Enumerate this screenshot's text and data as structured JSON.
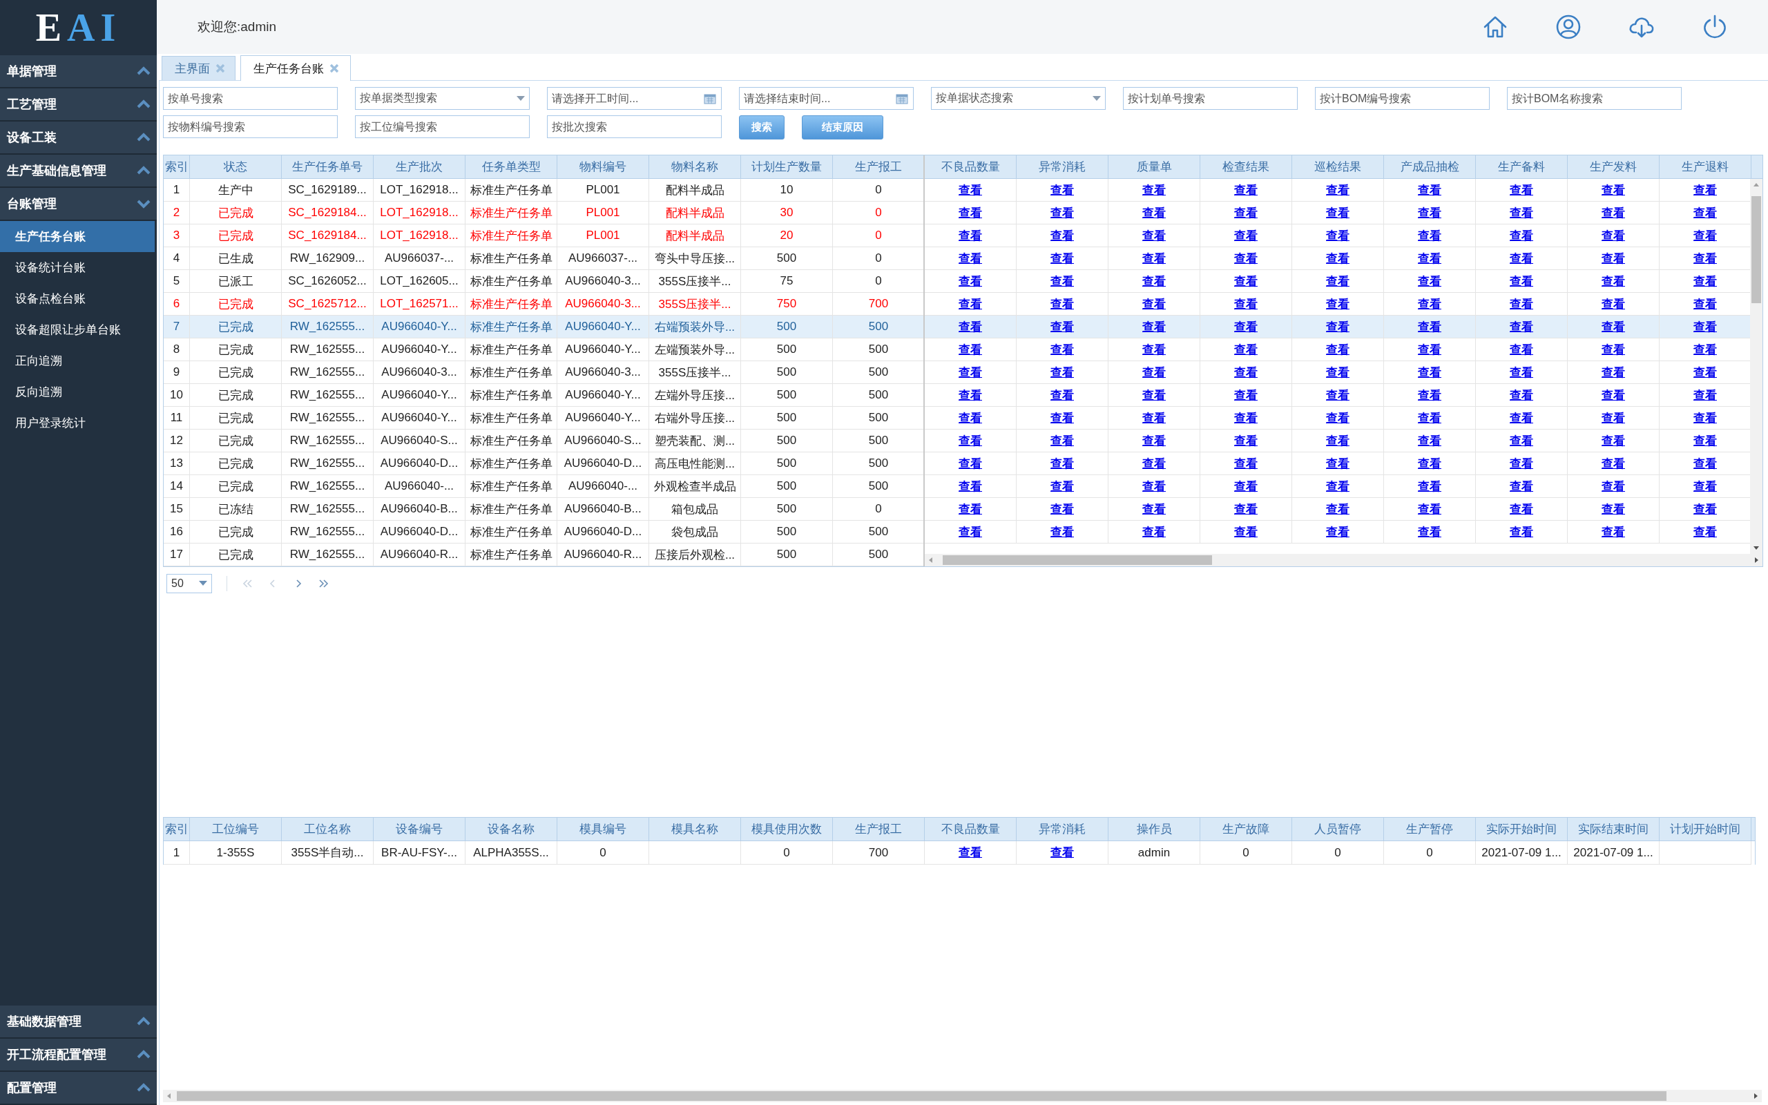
{
  "logo": [
    {
      "text": "E",
      "accent": false
    },
    {
      "text": "AI",
      "accent": true
    }
  ],
  "header": {
    "welcome": "欢迎您:admin"
  },
  "sidebar": {
    "groups": [
      {
        "label": "单据管理",
        "expanded": false
      },
      {
        "label": "工艺管理",
        "expanded": false
      },
      {
        "label": "设备工装",
        "expanded": false
      },
      {
        "label": "生产基础信息管理",
        "expanded": false
      },
      {
        "label": "台账管理",
        "expanded": true,
        "children": [
          {
            "label": "生产任务台账",
            "selected": true
          },
          {
            "label": "设备统计台账",
            "selected": false
          },
          {
            "label": "设备点检台账",
            "selected": false
          },
          {
            "label": "设备超限让步单台账",
            "selected": false
          },
          {
            "label": "正向追溯",
            "selected": false
          },
          {
            "label": "反向追溯",
            "selected": false
          },
          {
            "label": "用户登录统计",
            "selected": false
          }
        ]
      }
    ],
    "bottom_groups": [
      {
        "label": "基础数据管理",
        "expanded": false
      },
      {
        "label": "开工流程配置管理",
        "expanded": false
      },
      {
        "label": "配置管理",
        "expanded": false
      }
    ]
  },
  "tabs": [
    {
      "label": "主界面",
      "selected": false
    },
    {
      "label": "生产任务台账",
      "selected": true
    }
  ],
  "filters": [
    [
      {
        "kind": "text",
        "placeholder": "按单号搜索"
      },
      {
        "kind": "select",
        "placeholder": "按单据类型搜索"
      },
      {
        "kind": "date",
        "placeholder": "请选择开工时间..."
      },
      {
        "kind": "date",
        "placeholder": "请选择结束时间..."
      },
      {
        "kind": "select",
        "placeholder": "按单据状态搜索"
      },
      {
        "kind": "text",
        "placeholder": "按计划单号搜索"
      },
      {
        "kind": "text",
        "placeholder": "按计BOM编号搜索"
      },
      {
        "kind": "text",
        "placeholder": "按计BOM名称搜索"
      }
    ],
    [
      {
        "kind": "text",
        "placeholder": "按物料编号搜索"
      },
      {
        "kind": "text",
        "placeholder": "按工位编号搜索"
      },
      {
        "kind": "text",
        "placeholder": "按批次搜索"
      },
      {
        "kind": "button",
        "label": "搜索"
      },
      {
        "kind": "button",
        "label": "结束原因"
      }
    ]
  ],
  "top_table": {
    "columns": [
      "索引",
      "状态",
      "生产任务单号",
      "生产批次",
      "任务单类型",
      "物料编号",
      "物料名称",
      "计划生产数量",
      "生产报工"
    ],
    "link_columns": [
      "不良品数量",
      "异常消耗",
      "质量单",
      "检查结果",
      "巡检结果",
      "产成品抽检",
      "生产备料",
      "生产发料",
      "生产退料"
    ],
    "rows": [
      {
        "selected": false,
        "alert": false,
        "cells": [
          "1",
          "生产中",
          "SC_1629189...",
          "LOT_162918...",
          "标准生产任务单",
          "PL001",
          "配料半成品",
          "10",
          "0"
        ],
        "links": [
          "查看",
          "查看",
          "查看",
          "查看",
          "查看",
          "查看",
          "查看",
          "查看",
          "查看"
        ]
      },
      {
        "selected": false,
        "alert": true,
        "cells": [
          "2",
          "已完成",
          "SC_1629184...",
          "LOT_162918...",
          "标准生产任务单",
          "PL001",
          "配料半成品",
          "30",
          "0"
        ],
        "links": [
          "查看",
          "查看",
          "查看",
          "查看",
          "查看",
          "查看",
          "查看",
          "查看",
          "查看"
        ]
      },
      {
        "selected": false,
        "alert": true,
        "cells": [
          "3",
          "已完成",
          "SC_1629184...",
          "LOT_162918...",
          "标准生产任务单",
          "PL001",
          "配料半成品",
          "20",
          "0"
        ],
        "links": [
          "查看",
          "查看",
          "查看",
          "查看",
          "查看",
          "查看",
          "查看",
          "查看",
          "查看"
        ]
      },
      {
        "selected": false,
        "alert": false,
        "cells": [
          "4",
          "已生成",
          "RW_162909...",
          "AU966037-...",
          "标准生产任务单",
          "AU966037-...",
          "弯头中导压接...",
          "500",
          "0"
        ],
        "links": [
          "查看",
          "查看",
          "查看",
          "查看",
          "查看",
          "查看",
          "查看",
          "查看",
          "查看"
        ]
      },
      {
        "selected": false,
        "alert": false,
        "cells": [
          "5",
          "已派工",
          "SC_1626052...",
          "LOT_162605...",
          "标准生产任务单",
          "AU966040-3...",
          "355S压接半...",
          "75",
          "0"
        ],
        "links": [
          "查看",
          "查看",
          "查看",
          "查看",
          "查看",
          "查看",
          "查看",
          "查看",
          "查看"
        ]
      },
      {
        "selected": false,
        "alert": true,
        "cells": [
          "6",
          "已完成",
          "SC_1625712...",
          "LOT_162571...",
          "标准生产任务单",
          "AU966040-3...",
          "355S压接半...",
          "750",
          "700"
        ],
        "links": [
          "查看",
          "查看",
          "查看",
          "查看",
          "查看",
          "查看",
          "查看",
          "查看",
          "查看"
        ]
      },
      {
        "selected": true,
        "alert": false,
        "cells": [
          "7",
          "已完成",
          "RW_162555...",
          "AU966040-Y...",
          "标准生产任务单",
          "AU966040-Y...",
          "右端预装外导...",
          "500",
          "500"
        ],
        "links": [
          "查看",
          "查看",
          "查看",
          "查看",
          "查看",
          "查看",
          "查看",
          "查看",
          "查看"
        ]
      },
      {
        "selected": false,
        "alert": false,
        "cells": [
          "8",
          "已完成",
          "RW_162555...",
          "AU966040-Y...",
          "标准生产任务单",
          "AU966040-Y...",
          "左端预装外导...",
          "500",
          "500"
        ],
        "links": [
          "查看",
          "查看",
          "查看",
          "查看",
          "查看",
          "查看",
          "查看",
          "查看",
          "查看"
        ]
      },
      {
        "selected": false,
        "alert": false,
        "cells": [
          "9",
          "已完成",
          "RW_162555...",
          "AU966040-3...",
          "标准生产任务单",
          "AU966040-3...",
          "355S压接半...",
          "500",
          "500"
        ],
        "links": [
          "查看",
          "查看",
          "查看",
          "查看",
          "查看",
          "查看",
          "查看",
          "查看",
          "查看"
        ]
      },
      {
        "selected": false,
        "alert": false,
        "cells": [
          "10",
          "已完成",
          "RW_162555...",
          "AU966040-Y...",
          "标准生产任务单",
          "AU966040-Y...",
          "左端外导压接...",
          "500",
          "500"
        ],
        "links": [
          "查看",
          "查看",
          "查看",
          "查看",
          "查看",
          "查看",
          "查看",
          "查看",
          "查看"
        ]
      },
      {
        "selected": false,
        "alert": false,
        "cells": [
          "11",
          "已完成",
          "RW_162555...",
          "AU966040-Y...",
          "标准生产任务单",
          "AU966040-Y...",
          "右端外导压接...",
          "500",
          "500"
        ],
        "links": [
          "查看",
          "查看",
          "查看",
          "查看",
          "查看",
          "查看",
          "查看",
          "查看",
          "查看"
        ]
      },
      {
        "selected": false,
        "alert": false,
        "cells": [
          "12",
          "已完成",
          "RW_162555...",
          "AU966040-S...",
          "标准生产任务单",
          "AU966040-S...",
          "塑壳装配、测...",
          "500",
          "500"
        ],
        "links": [
          "查看",
          "查看",
          "查看",
          "查看",
          "查看",
          "查看",
          "查看",
          "查看",
          "查看"
        ]
      },
      {
        "selected": false,
        "alert": false,
        "cells": [
          "13",
          "已完成",
          "RW_162555...",
          "AU966040-D...",
          "标准生产任务单",
          "AU966040-D...",
          "高压电性能测...",
          "500",
          "500"
        ],
        "links": [
          "查看",
          "查看",
          "查看",
          "查看",
          "查看",
          "查看",
          "查看",
          "查看",
          "查看"
        ]
      },
      {
        "selected": false,
        "alert": false,
        "cells": [
          "14",
          "已完成",
          "RW_162555...",
          "AU966040-...",
          "标准生产任务单",
          "AU966040-...",
          "外观检查半成品",
          "500",
          "500"
        ],
        "links": [
          "查看",
          "查看",
          "查看",
          "查看",
          "查看",
          "查看",
          "查看",
          "查看",
          "查看"
        ]
      },
      {
        "selected": false,
        "alert": false,
        "cells": [
          "15",
          "已冻结",
          "RW_162555...",
          "AU966040-B...",
          "标准生产任务单",
          "AU966040-B...",
          "箱包成品",
          "500",
          "0"
        ],
        "links": [
          "查看",
          "查看",
          "查看",
          "查看",
          "查看",
          "查看",
          "查看",
          "查看",
          "查看"
        ]
      },
      {
        "selected": false,
        "alert": false,
        "cells": [
          "16",
          "已完成",
          "RW_162555...",
          "AU966040-D...",
          "标准生产任务单",
          "AU966040-D...",
          "袋包成品",
          "500",
          "500"
        ],
        "links": [
          "查看",
          "查看",
          "查看",
          "查看",
          "查看",
          "查看",
          "查看",
          "查看",
          "查看"
        ]
      },
      {
        "selected": false,
        "alert": false,
        "cells": [
          "17",
          "已完成",
          "RW_162555...",
          "AU966040-R...",
          "标准生产任务单",
          "AU966040-R...",
          "压接后外观检...",
          "500",
          "500"
        ]
      }
    ]
  },
  "pager": {
    "page_size": "50",
    "nav": [
      {
        "kind": "first",
        "disabled": true
      },
      {
        "kind": "prev",
        "disabled": true
      },
      {
        "kind": "next",
        "disabled": false
      },
      {
        "kind": "last",
        "disabled": false
      }
    ]
  },
  "bottom_table": {
    "columns": [
      "索引",
      "工位编号",
      "工位名称",
      "设备编号",
      "设备名称",
      "模具编号",
      "模具名称",
      "模具使用次数",
      "生产报工",
      "不良品数量",
      "异常消耗",
      "操作员",
      "生产故障",
      "人员暂停",
      "生产暂停",
      "实际开始时间",
      "实际结束时间",
      "计划开始时间"
    ],
    "rows": [
      {
        "cells": [
          "1",
          "1-355S",
          "355S半自动...",
          "BR-AU-FSY-...",
          "ALPHA355S...",
          "0",
          null,
          "0",
          "700",
          {
            "kind": "link",
            "text": "查看"
          },
          {
            "kind": "link",
            "text": "查看"
          },
          "admin",
          "0",
          "0",
          "0",
          "2021-07-09 1...",
          "2021-07-09 1...",
          null
        ]
      }
    ]
  }
}
